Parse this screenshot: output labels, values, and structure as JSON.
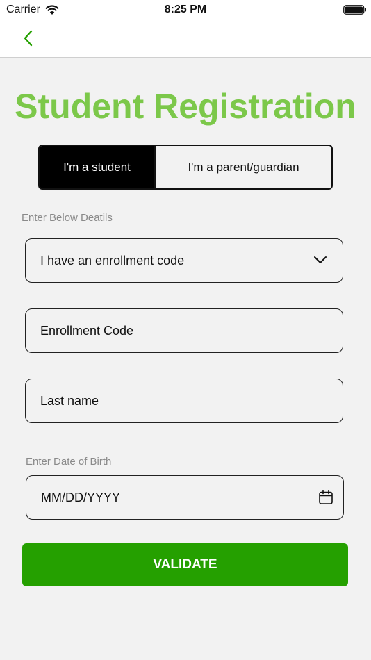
{
  "status_bar": {
    "carrier": "Carrier",
    "time": "8:25 PM",
    "wifi_icon": "wifi-icon",
    "battery_icon": "battery-icon"
  },
  "nav": {
    "back_icon": "chevron-left-icon",
    "accent_color": "#25a000"
  },
  "page": {
    "title": "Student Registration",
    "title_color": "#7cc84a"
  },
  "segmented": {
    "options": [
      "I'm a student",
      "I'm a parent/guardian"
    ],
    "selected": "I'm a student"
  },
  "form": {
    "details_label": "Enter Below Deatils",
    "enrollment_option": {
      "value": "I have an enrollment code",
      "icon": "chevron-down-icon"
    },
    "enrollment_code_placeholder": "Enrollment Code",
    "last_name_placeholder": "Last name",
    "dob_label": "Enter Date of Birth",
    "dob_placeholder": "MM/DD/YYYY",
    "dob_icon": "calendar-icon"
  },
  "actions": {
    "validate_label": "VALIDATE",
    "validate_color": "#25a000"
  }
}
